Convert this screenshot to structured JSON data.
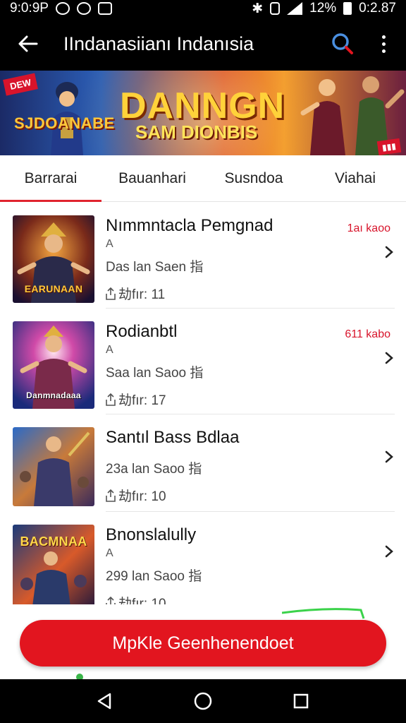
{
  "status_bar": {
    "time_left": "9:0:9P",
    "battery": "12%",
    "time_right": "0:2.87"
  },
  "app_bar": {
    "title": "IIndanasiianı Indanısia"
  },
  "banner": {
    "badge": "DEW",
    "left_text": "SJDOANABE",
    "title": "DANNGN",
    "subtitle": "SAM DIONBIS"
  },
  "tabs": [
    {
      "label": "Barrarai",
      "active": true
    },
    {
      "label": "Bauanhari",
      "active": false
    },
    {
      "label": "Susndoa",
      "active": false
    },
    {
      "label": "Viahai",
      "active": false
    }
  ],
  "list": [
    {
      "title": "Nımmntacla Pemgnad",
      "meta1": "A",
      "meta2": "Das lan Saen 指",
      "count": "劫fır: 11",
      "price": "1aı kaoo",
      "thumb_caption": "EARUNAAN"
    },
    {
      "title": "Rodianbtl",
      "meta1": "A",
      "meta2": "Saa lan Saoo 指",
      "count": "劫fır: 17",
      "price": "611 kabo",
      "thumb_caption": "Danmnadaaa"
    },
    {
      "title": "Santıl Bass Bdlaa",
      "meta1": "",
      "meta2": "23a lan Saoo 指",
      "count": "劫fır: 10",
      "price": "",
      "thumb_caption": ""
    },
    {
      "title": "Bnonslalully",
      "meta1": "A",
      "meta2": "299 lan Saoo 指",
      "count": "劫fır: 10",
      "price": "",
      "thumb_caption": "BACMNAA"
    }
  ],
  "cta": {
    "label": "MpKle Geenhenendoet"
  },
  "colors": {
    "accent": "#e2151f",
    "price": "#d8142b",
    "bar": "#000000"
  },
  "icons": {
    "back": "arrow-left-icon",
    "search": "search-icon",
    "more": "more-vert-icon",
    "chevron": "chevron-right-icon"
  }
}
